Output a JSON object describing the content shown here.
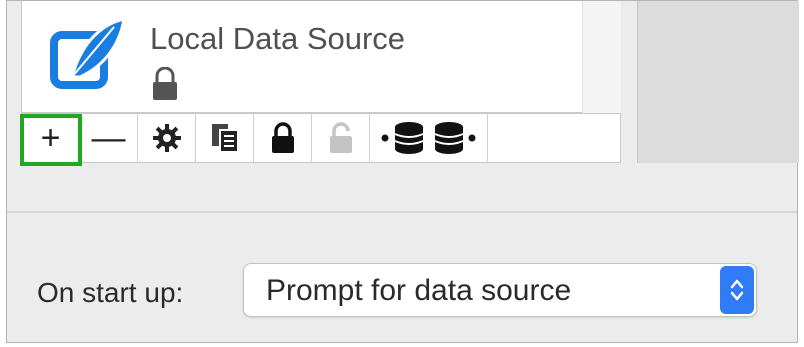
{
  "source_list": {
    "items": [
      {
        "label": "Local Data Source",
        "icon": "feather-database-icon",
        "locked": true
      }
    ]
  },
  "toolbar": {
    "buttons": [
      {
        "label": "+",
        "icon": "add-icon",
        "selected": true
      },
      {
        "label": "—",
        "icon": "remove-icon"
      },
      {
        "label": "",
        "icon": "gear-icon"
      },
      {
        "label": "",
        "icon": "duplicate-icon"
      },
      {
        "label": "",
        "icon": "lock-icon"
      },
      {
        "label": "",
        "icon": "unlock-icon",
        "disabled": true
      },
      {
        "label": "",
        "icon": "import-export-database-icon"
      }
    ]
  },
  "startup": {
    "label": "On start up:",
    "value": "Prompt for data source"
  },
  "colors": {
    "accent": "#2f7cf6",
    "icon_blue": "#1a7de0",
    "highlight": "#22a722"
  }
}
